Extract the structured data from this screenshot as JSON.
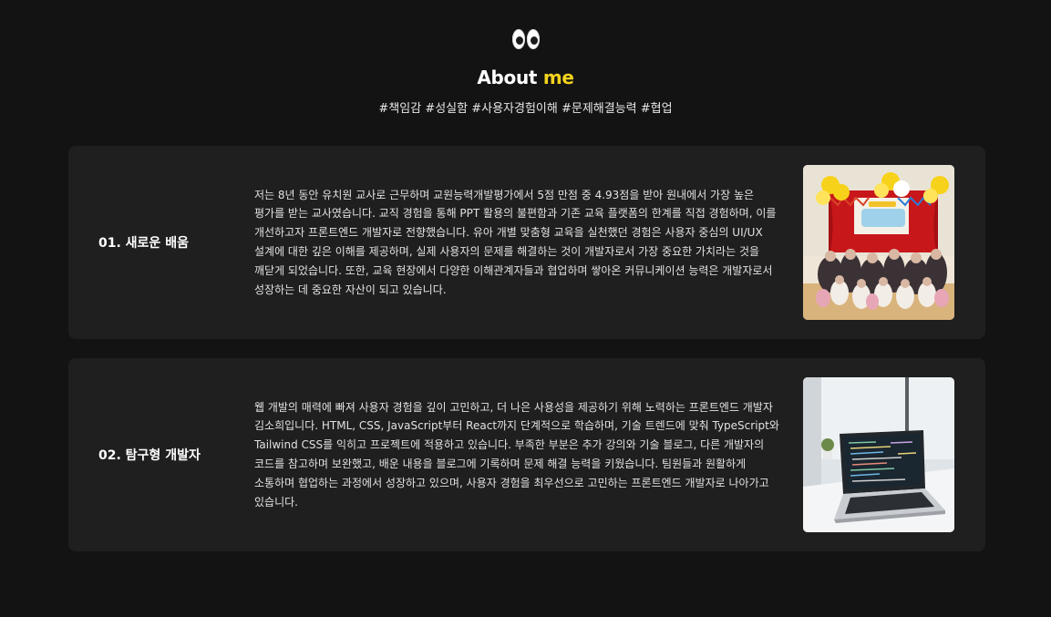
{
  "header": {
    "icon": "eyes-icon",
    "title_main": "About",
    "title_accent": "me",
    "tags": "#책임감 #성실함 #사용자경험이해 #문제해결능력 #협업"
  },
  "colors": {
    "background": "#131313",
    "card": "#1f1f1f",
    "accent": "#f3d21e"
  },
  "cards": [
    {
      "title": "01. 새로운 배움",
      "text": "저는 8년 동안 유치원 교사로 근무하며 교원능력개발평가에서 5점 만점 중 4.93점을 받아 원내에서 가장 높은 평가를 받는 교사였습니다. 교직 경험을 통해 PPT 활용의 불편함과 기존 교육 플랫폼의 한계를 직접 경험하며, 이를 개선하고자 프론트엔드 개발자로 전향했습니다. 유아 개별 맞춤형 교육을 실천했던 경험은 사용자 중심의 UI/UX 설계에 대한 깊은 이해를 제공하며, 실제 사용자의 문제를 해결하는 것이 개발자로서 가장 중요한 가치라는 것을 깨닫게 되었습니다. 또한, 교육 현장에서 다양한 이해관계자들과 협업하며 쌓아온 커뮤니케이션 능력은 개발자로서 성장하는 데 중요한 자산이 되고 있습니다.",
      "image": "kindergarten-class-photo"
    },
    {
      "title": "02. 탐구형 개발자",
      "text": "웹 개발의 매력에 빠져 사용자 경험을 깊이 고민하고, 더 나은 사용성을 제공하기 위해 노력하는 프론트엔드 개발자 김소희입니다. HTML, CSS, JavaScript부터 React까지 단계적으로 학습하며, 기술 트렌드에 맞춰 TypeScript와 Tailwind CSS를 익히고 프로젝트에 적용하고 있습니다. 부족한 부분은 추가 강의와 기술 블로그, 다른 개발자의 코드를 참고하며 보완했고, 배운 내용을 블로그에 기록하며 문제 해결 능력을 키웠습니다. 팀원들과 원활하게 소통하며 협업하는 과정에서 성장하고 있으며, 사용자 경험을 최우선으로 고민하는 프론트엔드 개발자로 나아가고 있습니다.",
      "image": "laptop-code-photo"
    }
  ]
}
